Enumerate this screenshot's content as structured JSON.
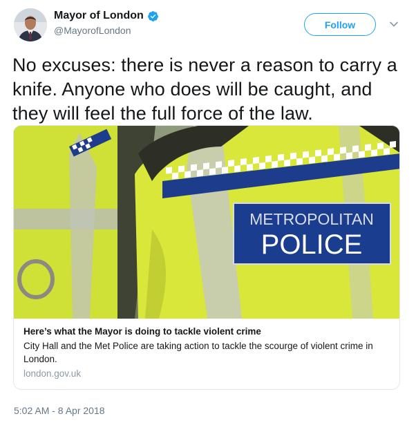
{
  "author": {
    "display_name": "Mayor of London",
    "handle": "@MayorofLondon",
    "verified": true
  },
  "actions": {
    "follow_label": "Follow"
  },
  "tweet": {
    "text": "No excuses: there is never a reason to carry a knife. Anyone who does will be caught, and they will feel the full force of the law.",
    "timestamp": "5:02 AM - 8 Apr 2018"
  },
  "card": {
    "image_patch_line1": "METROPOLITAN",
    "image_patch_line2": "POLICE",
    "title": "Here’s what the Mayor is doing to tackle violent crime",
    "description": "City Hall and the Met Police are taking action to tackle the scourge of violent crime in London.",
    "domain": "london.gov.uk"
  },
  "colors": {
    "accent": "#1da1f2",
    "text": "#14171a",
    "secondary_text": "#657786",
    "hi_vis_yellow": "#d7e636",
    "patch_blue": "#1b3d8f"
  },
  "icons": {
    "verified": "verified-badge-icon",
    "caret": "chevron-down-icon"
  }
}
